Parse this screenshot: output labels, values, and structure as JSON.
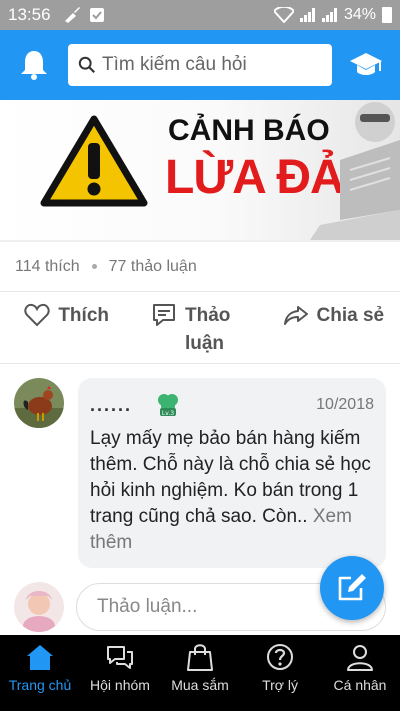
{
  "status_bar": {
    "time": "13:56",
    "battery": "34%"
  },
  "header": {
    "search_placeholder": "Tìm kiếm câu hỏi"
  },
  "banner": {
    "line1": "CẢNH BÁO",
    "line2": "LỪA ĐẢO"
  },
  "stats": {
    "likes": "114 thích",
    "discussions": "77 thảo luận"
  },
  "actions": {
    "like": "Thích",
    "discuss": "Thảo luận",
    "share": "Chia sẻ"
  },
  "comment": {
    "user": "......",
    "badge": "Lv.3",
    "date": "10/2018",
    "text": "Lạy mấy mẹ bảo bán hàng kiếm thêm. Chỗ này là chỗ chia sẻ học hỏi kinh nghiệm. Ko bán trong 1 trang cũng chả sao. Còn..",
    "more": "Xem thêm"
  },
  "reply": {
    "placeholder": "Thảo luận..."
  },
  "nav": [
    {
      "label": "Trang chủ"
    },
    {
      "label": "Hội nhóm"
    },
    {
      "label": "Mua sắm"
    },
    {
      "label": "Trợ lý"
    },
    {
      "label": "Cá nhân"
    }
  ],
  "colors": {
    "primary": "#2196f3",
    "status_bar": "#9e9e9e",
    "warning_red": "#e21c1c"
  }
}
